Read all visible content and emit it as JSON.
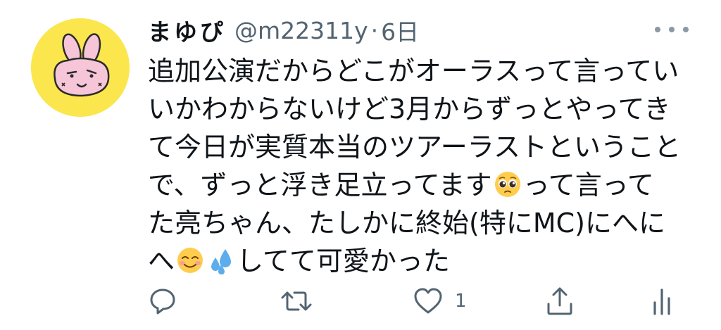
{
  "tweet": {
    "display_name": "まゆぴ",
    "handle": "@m22311y",
    "separator": "·",
    "time": "6日",
    "lines": [
      "追加公演だからどこがオーラスって言ってい",
      "いかわからないけど3月からずっとやってき",
      "て今日が実質本当のツアーラストということ",
      "で、ずっと浮き足立ってます",
      "って言って",
      "た亮ちゃん、たしかに終始(特にMC)にへに",
      "へ",
      "してて可愛かった"
    ],
    "emojis": {
      "pleading": "pleading-face-emoji",
      "smiling": "smiling-face-emoji",
      "sweat": "sweat-droplets-emoji"
    },
    "actions": {
      "reply_icon": "reply-icon",
      "retweet_icon": "retweet-icon",
      "like_icon": "heart-icon",
      "like_count": "1",
      "share_icon": "share-icon",
      "analytics_icon": "analytics-icon"
    },
    "colors": {
      "avatar_bg": "#fbe64d",
      "secondary_text": "#536471",
      "primary_text": "#0f1419"
    }
  }
}
